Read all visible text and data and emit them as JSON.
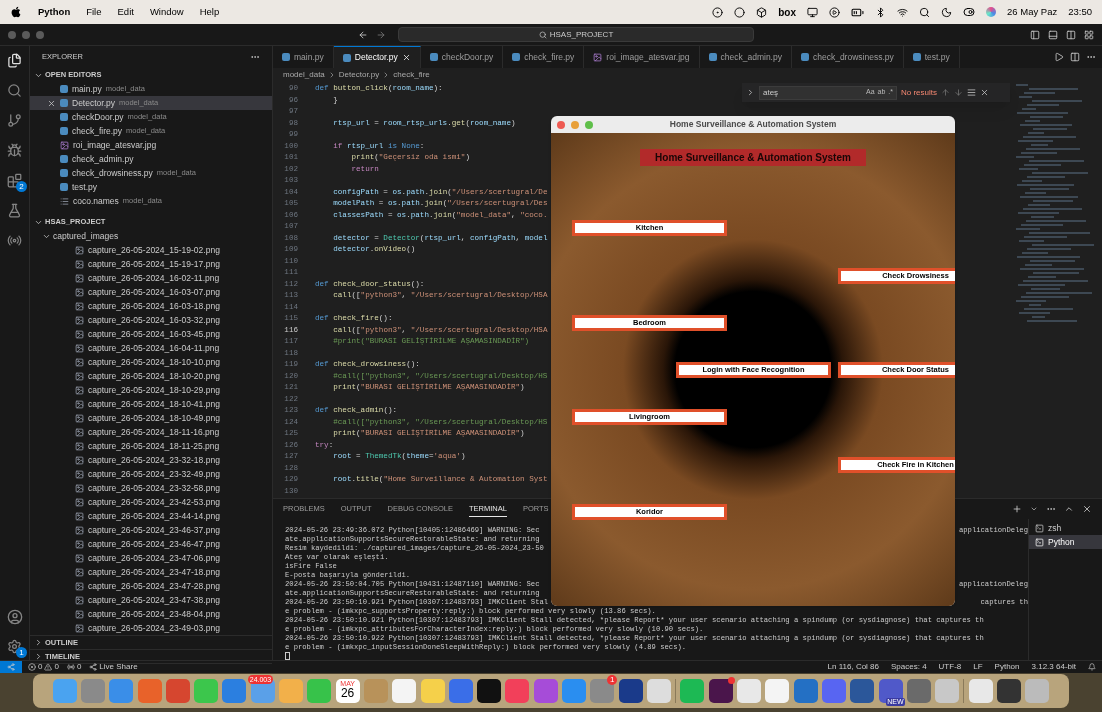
{
  "menubar": {
    "app": "Python",
    "menus": [
      "File",
      "Edit",
      "Window",
      "Help"
    ],
    "box_label": "box",
    "date": "26 May Paz",
    "time": "23:50"
  },
  "window": {
    "search": "HSAS_PROJECT"
  },
  "activity_bar": {
    "extensions_badge": "2",
    "settings_badge": "1"
  },
  "sidebar": {
    "title": "EXPLORER",
    "open_editors": {
      "title": "OPEN EDITORS",
      "expanded": true,
      "items": [
        {
          "name": "main.py",
          "dir": "model_data",
          "kind": "py",
          "selected": false
        },
        {
          "name": "Detector.py",
          "dir": "model_data",
          "kind": "py",
          "selected": true
        },
        {
          "name": "checkDoor.py",
          "dir": "model_data",
          "kind": "py",
          "selected": false
        },
        {
          "name": "check_fire.py",
          "dir": "model_data",
          "kind": "py",
          "selected": false
        },
        {
          "name": "roi_image_atesvar.jpg",
          "kind": "img",
          "selected": false
        },
        {
          "name": "check_admin.py",
          "kind": "py",
          "selected": false
        },
        {
          "name": "check_drowsiness.py",
          "dir": "model_data",
          "kind": "py",
          "selected": false
        },
        {
          "name": "test.py",
          "kind": "py",
          "selected": false
        },
        {
          "name": "coco.names",
          "dir": "model_data",
          "kind": "txt",
          "selected": false
        }
      ]
    },
    "project": {
      "title": "HSAS_PROJECT",
      "expanded": true,
      "children": [
        {
          "name": "captured_images",
          "expanded": true,
          "children": [
            {
              "name": "capture_26-05-2024_15-19-02.png"
            },
            {
              "name": "capture_26-05-2024_15-19-17.png"
            },
            {
              "name": "capture_26-05-2024_16-02-11.png"
            },
            {
              "name": "capture_26-05-2024_16-03-07.png"
            },
            {
              "name": "capture_26-05-2024_16-03-18.png"
            },
            {
              "name": "capture_26-05-2024_16-03-32.png"
            },
            {
              "name": "capture_26-05-2024_16-03-45.png"
            },
            {
              "name": "capture_26-05-2024_16-04-11.png"
            },
            {
              "name": "capture_26-05-2024_18-10-10.png"
            },
            {
              "name": "capture_26-05-2024_18-10-20.png"
            },
            {
              "name": "capture_26-05-2024_18-10-29.png"
            },
            {
              "name": "capture_26-05-2024_18-10-41.png"
            },
            {
              "name": "capture_26-05-2024_18-10-49.png"
            },
            {
              "name": "capture_26-05-2024_18-11-16.png"
            },
            {
              "name": "capture_26-05-2024_18-11-25.png"
            },
            {
              "name": "capture_26-05-2024_23-32-18.png"
            },
            {
              "name": "capture_26-05-2024_23-32-49.png"
            },
            {
              "name": "capture_26-05-2024_23-32-58.png"
            },
            {
              "name": "capture_26-05-2024_23-42-53.png"
            },
            {
              "name": "capture_26-05-2024_23-44-14.png"
            },
            {
              "name": "capture_26-05-2024_23-46-37.png"
            },
            {
              "name": "capture_26-05-2024_23-46-47.png"
            },
            {
              "name": "capture_26-05-2024_23-47-06.png"
            },
            {
              "name": "capture_26-05-2024_23-47-18.png"
            },
            {
              "name": "capture_26-05-2024_23-47-28.png"
            },
            {
              "name": "capture_26-05-2024_23-47-38.png"
            },
            {
              "name": "capture_26-05-2024_23-48-04.png"
            },
            {
              "name": "capture_26-05-2024_23-49-03.png"
            }
          ]
        }
      ]
    },
    "sections": [
      {
        "title": "OUTLINE",
        "expanded": false
      },
      {
        "title": "TIMELINE",
        "expanded": false
      }
    ]
  },
  "tabs": [
    {
      "label": "main.py",
      "kind": "py",
      "selected": false
    },
    {
      "label": "Detector.py",
      "kind": "py",
      "selected": true
    },
    {
      "label": "checkDoor.py",
      "kind": "py",
      "selected": false
    },
    {
      "label": "check_fire.py",
      "kind": "py",
      "selected": false
    },
    {
      "label": "roi_image_atesvar.jpg",
      "kind": "img",
      "selected": false
    },
    {
      "label": "check_admin.py",
      "kind": "py",
      "selected": false
    },
    {
      "label": "check_drowsiness.py",
      "kind": "py",
      "selected": false
    },
    {
      "label": "test.py",
      "kind": "py",
      "selected": false
    }
  ],
  "breadcrumbs": [
    "model_data",
    "Detector.py",
    "check_fire"
  ],
  "find": {
    "value": "ateş",
    "options": [
      "Aa",
      "ab",
      ".*"
    ],
    "result": "No results"
  },
  "code": [
    {
      "num": "90",
      "current": false,
      "tokens": [
        {
          "kind": "kw",
          "text": "def "
        },
        {
          "kind": "fn",
          "text": "button_click"
        },
        {
          "kind": "tx",
          "text": "("
        },
        {
          "kind": "var",
          "text": "room_name"
        },
        {
          "kind": "tx",
          "text": "):"
        }
      ]
    },
    {
      "num": "96",
      "current": false,
      "tokens": [
        {
          "kind": "tx",
          "text": "    }"
        }
      ]
    },
    {
      "num": "97",
      "current": false
    },
    {
      "num": "98",
      "current": false,
      "tokens": [
        {
          "kind": "var",
          "text": "    rtsp_url"
        },
        {
          "kind": "tx",
          "text": " = "
        },
        {
          "kind": "var",
          "text": "room_rtsp_urls"
        },
        {
          "kind": "tx",
          "text": "."
        },
        {
          "kind": "fn",
          "text": "get"
        },
        {
          "kind": "tx",
          "text": "("
        },
        {
          "kind": "var",
          "text": "room_name"
        },
        {
          "kind": "tx",
          "text": ")"
        }
      ]
    },
    {
      "num": "99",
      "current": false
    },
    {
      "num": "100",
      "current": false,
      "tokens": [
        {
          "kind": "ctl",
          "text": "    if "
        },
        {
          "kind": "var",
          "text": "rtsp_url"
        },
        {
          "kind": "kw",
          "text": " is None"
        },
        {
          "kind": "tx",
          "text": ":"
        }
      ]
    },
    {
      "num": "101",
      "current": false,
      "tokens": [
        {
          "kind": "fn",
          "text": "        print"
        },
        {
          "kind": "tx",
          "text": "("
        },
        {
          "kind": "str",
          "text": "\"Geçersiz oda ismi\""
        },
        {
          "kind": "tx",
          "text": ")"
        }
      ]
    },
    {
      "num": "102",
      "current": false,
      "tokens": [
        {
          "kind": "ctl",
          "text": "        return"
        }
      ]
    },
    {
      "num": "103",
      "current": false
    },
    {
      "num": "104",
      "current": false,
      "tokens": [
        {
          "kind": "var",
          "text": "    configPath"
        },
        {
          "kind": "tx",
          "text": " = "
        },
        {
          "kind": "var",
          "text": "os"
        },
        {
          "kind": "tx",
          "text": "."
        },
        {
          "kind": "var",
          "text": "path"
        },
        {
          "kind": "tx",
          "text": "."
        },
        {
          "kind": "fn",
          "text": "join"
        },
        {
          "kind": "tx",
          "text": "("
        },
        {
          "kind": "str",
          "text": "\"/Users/scertugral/De"
        }
      ]
    },
    {
      "num": "105",
      "current": false,
      "tokens": [
        {
          "kind": "var",
          "text": "    modelPath"
        },
        {
          "kind": "tx",
          "text": " = "
        },
        {
          "kind": "var",
          "text": "os"
        },
        {
          "kind": "tx",
          "text": "."
        },
        {
          "kind": "var",
          "text": "path"
        },
        {
          "kind": "tx",
          "text": "."
        },
        {
          "kind": "fn",
          "text": "join"
        },
        {
          "kind": "tx",
          "text": "("
        },
        {
          "kind": "str",
          "text": "\"/Users/scertugral/Des"
        }
      ]
    },
    {
      "num": "106",
      "current": false,
      "tokens": [
        {
          "kind": "var",
          "text": "    classesPath"
        },
        {
          "kind": "tx",
          "text": " = "
        },
        {
          "kind": "var",
          "text": "os"
        },
        {
          "kind": "tx",
          "text": "."
        },
        {
          "kind": "var",
          "text": "path"
        },
        {
          "kind": "tx",
          "text": "."
        },
        {
          "kind": "fn",
          "text": "join"
        },
        {
          "kind": "tx",
          "text": "("
        },
        {
          "kind": "str",
          "text": "\"model_data\""
        },
        {
          "kind": "tx",
          "text": ", "
        },
        {
          "kind": "str",
          "text": "\"coco."
        }
      ]
    },
    {
      "num": "107",
      "current": false
    },
    {
      "num": "108",
      "current": false,
      "tokens": [
        {
          "kind": "var",
          "text": "    detector"
        },
        {
          "kind": "tx",
          "text": " = "
        },
        {
          "kind": "cls",
          "text": "Detector"
        },
        {
          "kind": "tx",
          "text": "("
        },
        {
          "kind": "var",
          "text": "rtsp_url"
        },
        {
          "kind": "tx",
          "text": ", "
        },
        {
          "kind": "var",
          "text": "configPath"
        },
        {
          "kind": "tx",
          "text": ", "
        },
        {
          "kind": "var",
          "text": "model"
        }
      ]
    },
    {
      "num": "109",
      "current": false,
      "tokens": [
        {
          "kind": "var",
          "text": "    detector"
        },
        {
          "kind": "tx",
          "text": "."
        },
        {
          "kind": "fn",
          "text": "onVideo"
        },
        {
          "kind": "tx",
          "text": "()"
        }
      ]
    },
    {
      "num": "110",
      "current": false
    },
    {
      "num": "111",
      "current": false
    },
    {
      "num": "112",
      "current": false,
      "tokens": [
        {
          "kind": "kw",
          "text": "def "
        },
        {
          "kind": "fn",
          "text": "check_door_status"
        },
        {
          "kind": "tx",
          "text": "():"
        }
      ]
    },
    {
      "num": "113",
      "current": false,
      "tokens": [
        {
          "kind": "fn",
          "text": "    call"
        },
        {
          "kind": "tx",
          "text": "(["
        },
        {
          "kind": "str",
          "text": "\"python3\""
        },
        {
          "kind": "tx",
          "text": ", "
        },
        {
          "kind": "str",
          "text": "\"/Users/scertugral/Desktop/HSA"
        }
      ]
    },
    {
      "num": "114",
      "current": false
    },
    {
      "num": "115",
      "current": false,
      "tokens": [
        {
          "kind": "kw",
          "text": "def "
        },
        {
          "kind": "fn",
          "text": "check_fire"
        },
        {
          "kind": "tx",
          "text": "():"
        }
      ]
    },
    {
      "num": "116",
      "current": true,
      "tokens": [
        {
          "kind": "fn",
          "text": "    call"
        },
        {
          "kind": "tx",
          "text": "(["
        },
        {
          "kind": "str",
          "text": "\"python3\""
        },
        {
          "kind": "tx",
          "text": ", "
        },
        {
          "kind": "str",
          "text": "\"/Users/scertugral/Desktop/HSA"
        }
      ]
    },
    {
      "num": "117",
      "current": false,
      "tokens": [
        {
          "kind": "cm",
          "text": "    #print(\"BURASI GELİŞTİRİLME AŞAMASINDADİR\")"
        }
      ]
    },
    {
      "num": "118",
      "current": false
    },
    {
      "num": "119",
      "current": false,
      "tokens": [
        {
          "kind": "kw",
          "text": "def "
        },
        {
          "kind": "fn",
          "text": "check_drowsiness"
        },
        {
          "kind": "tx",
          "text": "():"
        }
      ]
    },
    {
      "num": "120",
      "current": false,
      "tokens": [
        {
          "kind": "cm",
          "text": "    #call([\"python3\", \"/Users/scertugral/Desktop/HS"
        }
      ]
    },
    {
      "num": "121",
      "current": false,
      "tokens": [
        {
          "kind": "fn",
          "text": "    print"
        },
        {
          "kind": "tx",
          "text": "("
        },
        {
          "kind": "str",
          "text": "\"BURASI GELİŞTİRİLME AŞAMASINDADİR\""
        },
        {
          "kind": "tx",
          "text": ")"
        }
      ]
    },
    {
      "num": "122",
      "current": false
    },
    {
      "num": "123",
      "current": false,
      "tokens": [
        {
          "kind": "kw",
          "text": "def "
        },
        {
          "kind": "fn",
          "text": "check_admin"
        },
        {
          "kind": "tx",
          "text": "():"
        }
      ]
    },
    {
      "num": "124",
      "current": false,
      "tokens": [
        {
          "kind": "cm",
          "text": "    #call([\"python3\", \"/Users/scertugral/Desktop/HS"
        }
      ]
    },
    {
      "num": "125",
      "current": false,
      "tokens": [
        {
          "kind": "fn",
          "text": "    print"
        },
        {
          "kind": "tx",
          "text": "("
        },
        {
          "kind": "str",
          "text": "\"BURASI GELİŞTİRİLME AŞAMASINDADİR\""
        },
        {
          "kind": "tx",
          "text": ")"
        }
      ]
    },
    {
      "num": "126",
      "current": false,
      "tokens": [
        {
          "kind": "ctl",
          "text": "try"
        },
        {
          "kind": "tx",
          "text": ":"
        }
      ]
    },
    {
      "num": "127",
      "current": false,
      "tokens": [
        {
          "kind": "var",
          "text": "    root"
        },
        {
          "kind": "tx",
          "text": " = "
        },
        {
          "kind": "cls",
          "text": "ThemedTk"
        },
        {
          "kind": "tx",
          "text": "("
        },
        {
          "kind": "var",
          "text": "theme"
        },
        {
          "kind": "tx",
          "text": "="
        },
        {
          "kind": "str",
          "text": "'aqua'"
        },
        {
          "kind": "tx",
          "text": ")"
        }
      ]
    },
    {
      "num": "128",
      "current": false
    },
    {
      "num": "129",
      "current": false,
      "tokens": [
        {
          "kind": "var",
          "text": "    root"
        },
        {
          "kind": "tx",
          "text": "."
        },
        {
          "kind": "fn",
          "text": "title"
        },
        {
          "kind": "tx",
          "text": "("
        },
        {
          "kind": "str",
          "text": "\"Home Surveillance & Automation Syst"
        }
      ]
    },
    {
      "num": "130",
      "current": false
    }
  ],
  "panel": {
    "tabs": [
      {
        "label": "PROBLEMS",
        "selected": false
      },
      {
        "label": "OUTPUT",
        "selected": false
      },
      {
        "label": "DEBUG CONSOLE",
        "selected": false
      },
      {
        "label": "TERMINAL",
        "selected": true
      },
      {
        "label": "PORTS",
        "selected": false
      }
    ],
    "terminal": [
      {
        "text": "2024-05-26 23:49:36.072 Python[10405:12486469] WARNING: Sec",
        "tail": "applicationDeleg"
      },
      {
        "text": "ate.applicationSupportsSecureRestorableState: and returning"
      },
      {
        "text": "Resim kaydedildi: ./captured_images/capture_26-05-2024_23-50"
      },
      {
        "text": "Ateş var olarak eşleşti."
      },
      {
        "text": "isFire False"
      },
      {
        "text": "E-posta başarıyla gönderildi."
      },
      {
        "text": "2024-05-26 23:50:04.705 Python[10431:12487110] WARNING: Sec",
        "tail": "applicationDeleg"
      },
      {
        "text": "ate.applicationSupportsSecureRestorableState: and returning"
      },
      {
        "text": "2024-05-26 23:50:10.921 Python[10307:12483793] IMKClient Stal",
        "tail": "captures th"
      },
      {
        "text": "e problem - (imkxpc_supportsProperty:reply:) block performed very slowly (13.86 secs)."
      },
      {
        "text": "2024-05-26 23:50:10.921 Python[10307:12483793] IMKClient Stall detected, *please Report* your user scenario attaching a spindump (or sysdiagnose) that captures th"
      },
      {
        "text": "e problem - (imkxpc_attributesForCharacterIndex:reply:) block performed very slowly (10.90 secs)."
      },
      {
        "text": "2024-05-26 23:50:10.922 Python[10307:12483793] IMKClient Stall detected, *please Report* your user scenario attaching a spindump (or sysdiagnose) that captures th"
      },
      {
        "text": "e problem - (imkxpc_inputSessionDoneSleepWithReply:) block performed very slowly (4.89 secs)."
      }
    ],
    "sessions": [
      {
        "label": "zsh",
        "selected": false
      },
      {
        "label": "Python",
        "selected": true
      }
    ]
  },
  "status_bar": {
    "errors": "0",
    "warnings": "0",
    "ports": "0",
    "live_share": "Live Share",
    "right": [
      "Ln 116, Col 86",
      "Spaces: 4",
      "UTF-8",
      "LF",
      "Python",
      "3.12.3 64-bit"
    ]
  },
  "app_window": {
    "title": "Home Surveillance & Automation System",
    "heading": "Home Surveillance & Automation System",
    "buttons": [
      "Kitchen",
      "Check Drowsiness",
      "Bedroom",
      "Login with Face Recognition",
      "Check Door Status",
      "Livingroom",
      "Check Fire in Kitchen",
      "Koridor"
    ]
  },
  "dock": {
    "mail_badge": "24.003",
    "calendar_month": "MAY",
    "calendar_day": "26",
    "settings_badge": "1",
    "teams_tag": "NEW"
  }
}
